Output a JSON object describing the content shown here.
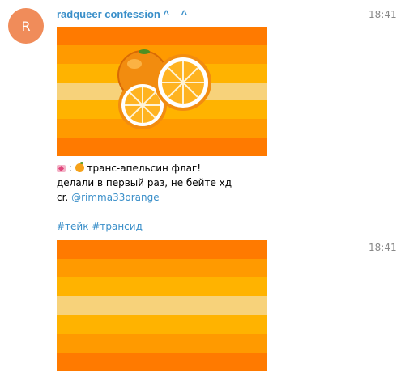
{
  "post": {
    "avatar_letter": "R",
    "avatar_color": "#f08c5a",
    "author": "radqueer confession ^__^",
    "time": "18:41",
    "flag_stripes": [
      "#ff7a00",
      "#ff9a00",
      "#ffb300",
      "#f7d27a",
      "#ffb300",
      "#ff9a00",
      "#ff7a00"
    ],
    "image_icon": "oranges-icon",
    "text": {
      "line1_sep": ":",
      "line1_text": "транс-апельсин флаг!",
      "line2": "делали в первый раз, не бейте хд",
      "credit_prefix": "cr.",
      "credit_link": "@rimma33orange",
      "hashtags": [
        "#тейк",
        "#трансид"
      ]
    }
  },
  "second_post": {
    "time": "18:41",
    "flag_stripes": [
      "#ff7a00",
      "#ff9a00",
      "#ffb300",
      "#f7d27a",
      "#ffb300",
      "#ff9a00",
      "#ff7a00"
    ]
  }
}
